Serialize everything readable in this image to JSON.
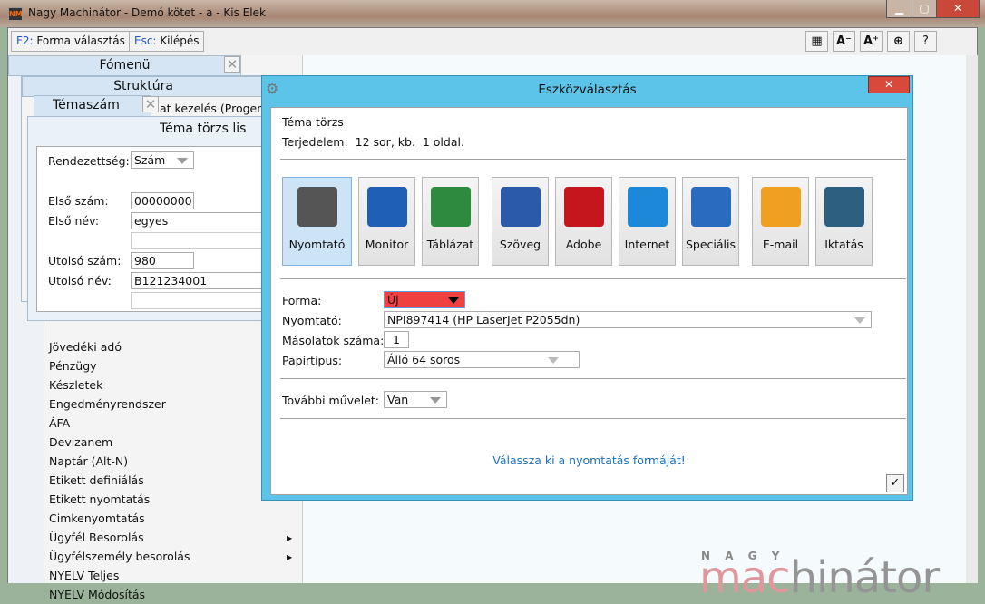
{
  "window": {
    "title": "Nagy Machinátor - Demó kötet - a - Kis Elek",
    "logo_text": "NM",
    "minimize": "▁",
    "maximize": "▢",
    "close": "✕"
  },
  "toolbar": {
    "f2_key": "F2:",
    "f2_label": "Forma választás",
    "esc_key": "Esc:",
    "esc_label": "Kilépés",
    "tile": "▦",
    "font_smaller": "A⁻",
    "font_larger": "A⁺",
    "nav": "⊕",
    "help": "?"
  },
  "fomenu": {
    "title": "Fómenü",
    "close": "✕",
    "items": [
      {
        "label": "Jövedéki adó"
      },
      {
        "label": "Pénzügy"
      },
      {
        "label": "Készletek"
      },
      {
        "label": "Engedményrendszer"
      },
      {
        "label": "ÁFA"
      },
      {
        "label": "Devizanem"
      },
      {
        "label": "Naptár (Alt-N)"
      },
      {
        "label": "Etikett definiálás"
      },
      {
        "label": "Etikett nyomtatás"
      },
      {
        "label": "Cimkenyomtatás"
      },
      {
        "label": "Ügyfél Besorolás",
        "submenu": true
      },
      {
        "label": "Ügyfélszemély besorolás",
        "submenu": true
      },
      {
        "label": "NYELV Teljes"
      },
      {
        "label": "NYELV Módosítás"
      }
    ]
  },
  "struktura": {
    "title": "Struktúra",
    "row": "at kezelés (Progen)"
  },
  "temaszam": {
    "title": "Témaszám",
    "close": "✕"
  },
  "tema_lista": {
    "title": "Téma törzs lis",
    "rendezettseg_label": "Rendezettség:",
    "rendezettseg_value": "Szám",
    "elso_szam_label": "Első szám:",
    "elso_szam": "00000000",
    "elso_nev_label": "Első név:",
    "elso_nev": "egyes",
    "utolso_szam_label": "Utolsó szám:",
    "utolso_szam": "980",
    "utolso_nev_label": "Utolsó név:",
    "utolso_nev": "B121234001"
  },
  "dialog": {
    "title": "Eszközválasztás",
    "close": "✕",
    "subject": "Téma törzs",
    "extent_label": "Terjedelem:",
    "extent_value": "12 sor, kb.  1 oldal.",
    "tools": [
      {
        "label": "Nyomtató",
        "icon": "printer-icon",
        "selected": true,
        "color": "#555"
      },
      {
        "label": "Monitor",
        "icon": "monitor-icon",
        "color": "#1f5fb5"
      },
      {
        "label": "Táblázat",
        "icon": "excel-icon",
        "color": "#2e8b3e"
      },
      {
        "label": "Szöveg",
        "icon": "word-icon",
        "color": "#2b5aaa"
      },
      {
        "label": "Adobe",
        "icon": "adobe-icon",
        "color": "#c4161c"
      },
      {
        "label": "Internet",
        "icon": "internet-explorer-icon",
        "color": "#1e88d8"
      },
      {
        "label": "Speciális",
        "icon": "special-monitor-icon",
        "color": "#2a6bbf"
      },
      {
        "label": "E-mail",
        "icon": "email-icon",
        "color": "#f0a020"
      },
      {
        "label": "Iktatás",
        "icon": "file-cabinet-icon",
        "color": "#2d5f80"
      }
    ],
    "forma_label": "Forma:",
    "forma_value": "Új",
    "forma_color": "#f04040",
    "nyomtato_label": "Nyomtató:",
    "nyomtato_value": "NPI897414 (HP LaserJet P2055dn)",
    "masolatok_label": "Másolatok száma:",
    "masolatok_value": "1",
    "papir_label": "Papírtípus:",
    "papir_value": "Álló 64 soros",
    "tovabbi_label": "További művelet:",
    "tovabbi_value": "Van",
    "message": "Válassza ki a nyomtatás formáját!",
    "ok": "✓"
  },
  "brand": {
    "top": "N A G Y",
    "left": "mac",
    "right": "hinátor"
  }
}
